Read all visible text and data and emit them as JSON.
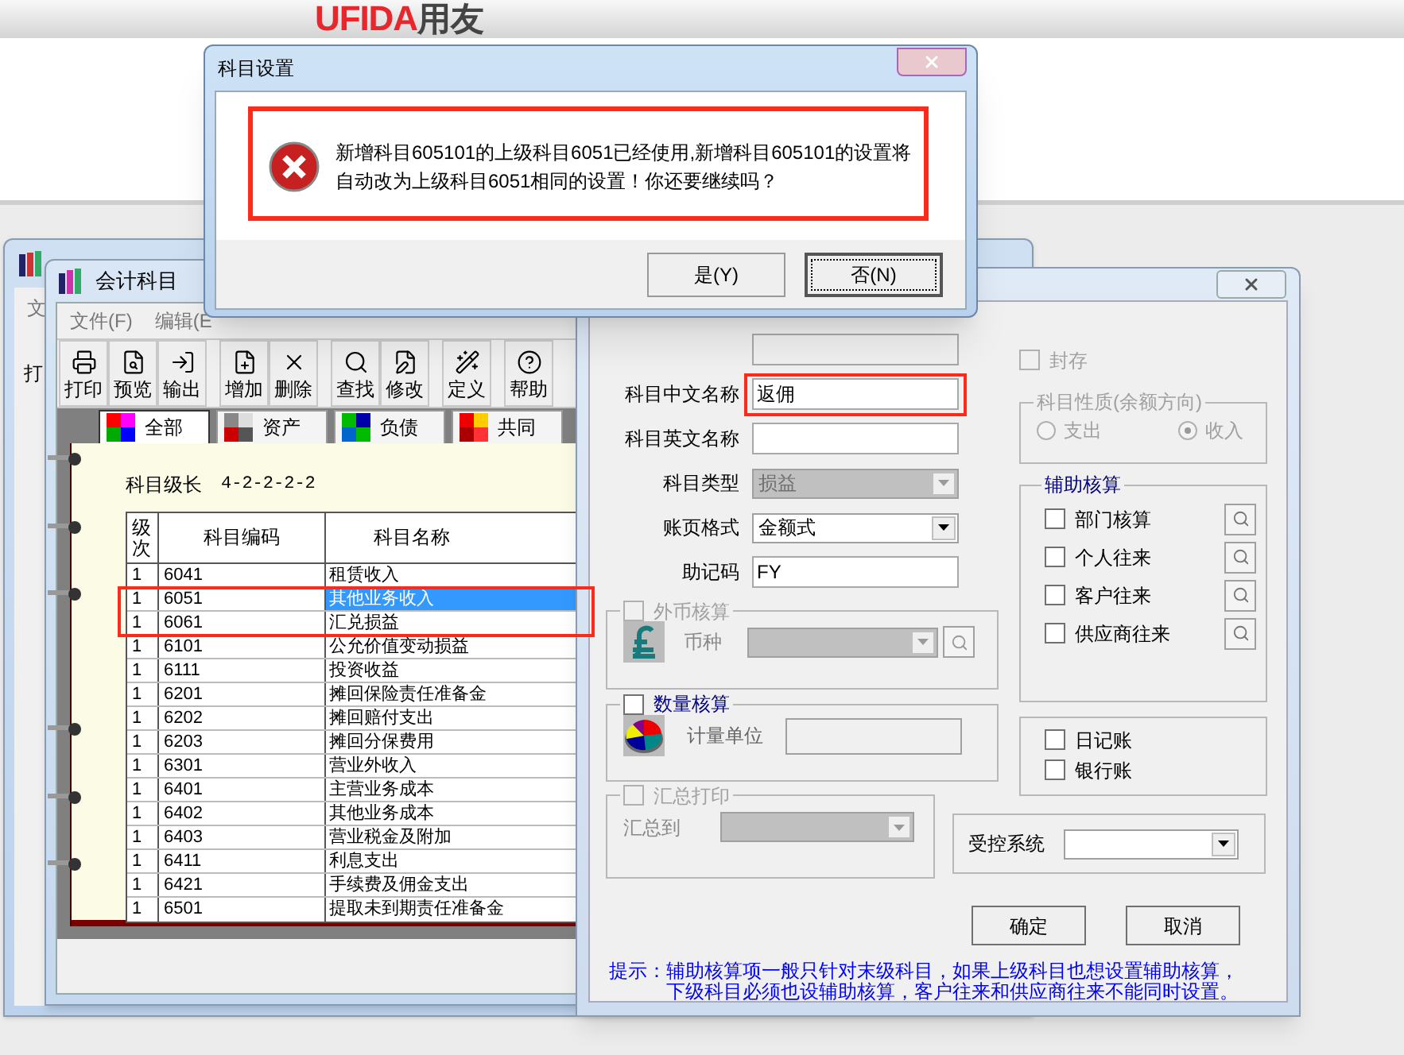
{
  "banner": {
    "logo_latin": "UFIDA",
    "logo_cjk": "用友"
  },
  "back_window": {
    "menu": "文",
    "toolbar": "打"
  },
  "subject_window": {
    "title": "会计科目",
    "menu": [
      "文件(F)",
      "编辑(E"
    ],
    "toolbar": [
      [
        "打印",
        "预览",
        "输出"
      ],
      [
        "增加",
        "删除"
      ],
      [
        "查找",
        "修改"
      ],
      [
        "定义"
      ],
      [
        "帮助"
      ]
    ],
    "tabs": [
      {
        "label": "全部",
        "selected": true
      },
      {
        "label": "资产",
        "selected": false
      },
      {
        "label": "负债",
        "selected": false
      },
      {
        "label": "共同",
        "selected": false
      }
    ],
    "level_length_label": "科目级长",
    "level_length": "4-2-2-2-2",
    "columns": [
      "级次",
      "科目编码",
      "科目名称"
    ],
    "rows": [
      {
        "level": "1",
        "code": "6041",
        "name": "租赁收入",
        "selected": false
      },
      {
        "level": "1",
        "code": "6051",
        "name": "其他业务收入",
        "selected": true
      },
      {
        "level": "1",
        "code": "6061",
        "name": "汇兑损益",
        "selected": false
      },
      {
        "level": "1",
        "code": "6101",
        "name": "公允价值变动损益",
        "selected": false
      },
      {
        "level": "1",
        "code": "6111",
        "name": "投资收益",
        "selected": false
      },
      {
        "level": "1",
        "code": "6201",
        "name": "摊回保险责任准备金",
        "selected": false
      },
      {
        "level": "1",
        "code": "6202",
        "name": "摊回赔付支出",
        "selected": false
      },
      {
        "level": "1",
        "code": "6203",
        "name": "摊回分保费用",
        "selected": false
      },
      {
        "level": "1",
        "code": "6301",
        "name": "营业外收入",
        "selected": false
      },
      {
        "level": "1",
        "code": "6401",
        "name": "主营业务成本",
        "selected": false
      },
      {
        "level": "1",
        "code": "6402",
        "name": "其他业务成本",
        "selected": false
      },
      {
        "level": "1",
        "code": "6403",
        "name": "营业税金及附加",
        "selected": false
      },
      {
        "level": "1",
        "code": "6411",
        "name": "利息支出",
        "selected": false
      },
      {
        "level": "1",
        "code": "6421",
        "name": "手续费及佣金支出",
        "selected": false
      },
      {
        "level": "1",
        "code": "6501",
        "name": "提取未到期责任准备金",
        "selected": false
      }
    ]
  },
  "edit_dialog": {
    "fields": [
      {
        "kind": "text",
        "disabled": true
      },
      {
        "label": "科目中文名称",
        "value": "返佣",
        "kind": "text",
        "disabled": false
      },
      {
        "label": "科目英文名称",
        "kind": "text",
        "disabled": false
      },
      {
        "label": "科目类型",
        "value": "损益",
        "kind": "select",
        "disabled": true
      },
      {
        "label": "账页格式",
        "value": "金额式",
        "kind": "select",
        "disabled": false
      },
      {
        "label": "助记码",
        "value": "FY",
        "kind": "text",
        "disabled": false
      }
    ],
    "foreign_currency": {
      "label": "外币核算",
      "checked": false,
      "disabled": true,
      "currency_label": "币种"
    },
    "quantity": {
      "label": "数量核算",
      "checked": false,
      "disabled": false,
      "unit_label": "计量单位"
    },
    "summary_print": {
      "label": "汇总打印",
      "checked": false,
      "disabled": true,
      "target_label": "汇总到"
    },
    "sealed": {
      "label": "封存",
      "checked": false,
      "disabled": true
    },
    "balance_direction": {
      "label": "科目性质(余额方向)",
      "disabled": true,
      "options": [
        {
          "label": "支出",
          "selected": false
        },
        {
          "label": "收入",
          "selected": true
        }
      ]
    },
    "auxiliary": {
      "title": "辅助核算",
      "items": [
        {
          "label": "部门核算",
          "checked": false
        },
        {
          "label": "个人往来",
          "checked": false
        },
        {
          "label": "客户往来",
          "checked": false
        },
        {
          "label": "供应商往来",
          "checked": false
        }
      ]
    },
    "books": [
      {
        "label": "日记账",
        "checked": false
      },
      {
        "label": "银行账",
        "checked": false
      }
    ],
    "controlled_system": {
      "label": "受控系统"
    },
    "buttons": [
      "确定",
      "取消"
    ],
    "hint": {
      "label": "提示：",
      "lines": [
        "辅助核算项一般只针对末级科目，如果上级科目也想设置辅助核算，",
        "下级科目必须也设辅助核算，客户往来和供应商往来不能同时设置。"
      ]
    }
  },
  "message_box": {
    "title": "科目设置",
    "message_lines": [
      "新增科目605101的上级科目6051已经使用,新增科目605101的设置将",
      "自动改为上级科目6051相同的设置！你还要继续吗？"
    ],
    "buttons": [
      {
        "label": "是(Y)",
        "selected": false
      },
      {
        "label": "否(N)",
        "selected": true
      }
    ]
  }
}
